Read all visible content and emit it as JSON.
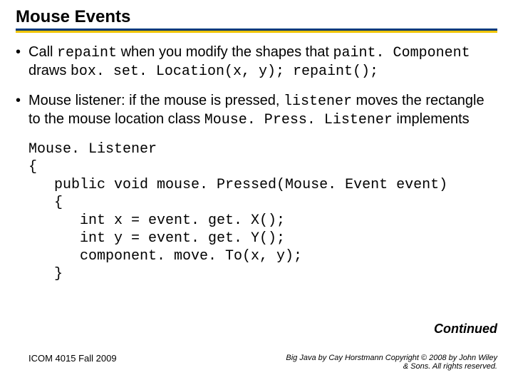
{
  "title": "Mouse Events",
  "bullet1": {
    "t1": "Call ",
    "c1": "repaint",
    "t2": " when you modify the shapes that ",
    "c2": "paint. Component",
    "t3": " draws ",
    "c3": "box. set. Location(x, y); repaint();"
  },
  "bullet2": {
    "t1": "Mouse listener: if the mouse is pressed, ",
    "c1": "listener",
    "t2": " moves the rectangle to the mouse location class ",
    "c2": "Mouse. Press. Listener",
    "t3": " implements"
  },
  "code": "Mouse. Listener\n{\n   public void mouse. Pressed(Mouse. Event event)\n   {\n      int x = event. get. X();\n      int y = event. get. Y();\n      component. move. To(x, y);\n   }",
  "continued": "Continued",
  "footer_left": "ICOM 4015 Fall 2009",
  "footer_right": "Big Java by Cay Horstmann Copyright © 2008 by John Wiley & Sons.  All rights reserved."
}
